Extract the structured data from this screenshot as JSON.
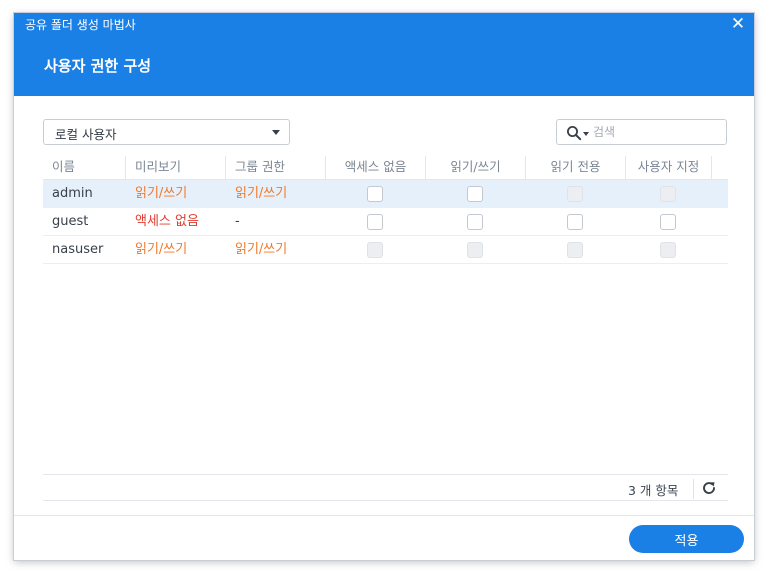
{
  "colors": {
    "accent": "#1a80e6",
    "rw_text": "#f0792a",
    "no_access_text": "#e03c31",
    "selected_row": "#e6f0fb"
  },
  "window": {
    "wizard_title": "공유 폴더 생성 마법사",
    "close_icon": "close-icon",
    "step_title": "사용자 권한 구성"
  },
  "toolbar": {
    "user_type_select": "로컬 사용자",
    "search_placeholder": "검색",
    "search_value": ""
  },
  "grid": {
    "columns": [
      "이름",
      "미리보기",
      "그룹 권한",
      "액세스 없음",
      "읽기/쓰기",
      "읽기 전용",
      "사용자 지정"
    ],
    "rows": [
      {
        "name": "admin",
        "preview": "읽기/쓰기",
        "preview_status": "rw",
        "group": "읽기/쓰기",
        "group_status": "rw",
        "selected": true,
        "checks": [
          "off",
          "off",
          "disabled",
          "disabled"
        ]
      },
      {
        "name": "guest",
        "preview": "액세스 없음",
        "preview_status": "no_access",
        "group": "-",
        "group_status": "none",
        "selected": false,
        "checks": [
          "off",
          "off",
          "off",
          "off"
        ]
      },
      {
        "name": "nasuser",
        "preview": "읽기/쓰기",
        "preview_status": "rw",
        "group": "읽기/쓰기",
        "group_status": "rw",
        "selected": false,
        "checks": [
          "disabled",
          "disabled",
          "disabled",
          "disabled"
        ]
      }
    ]
  },
  "footer": {
    "count": "3 개 항목",
    "refresh_icon": "refresh-icon"
  },
  "actions": {
    "apply": "적용"
  }
}
